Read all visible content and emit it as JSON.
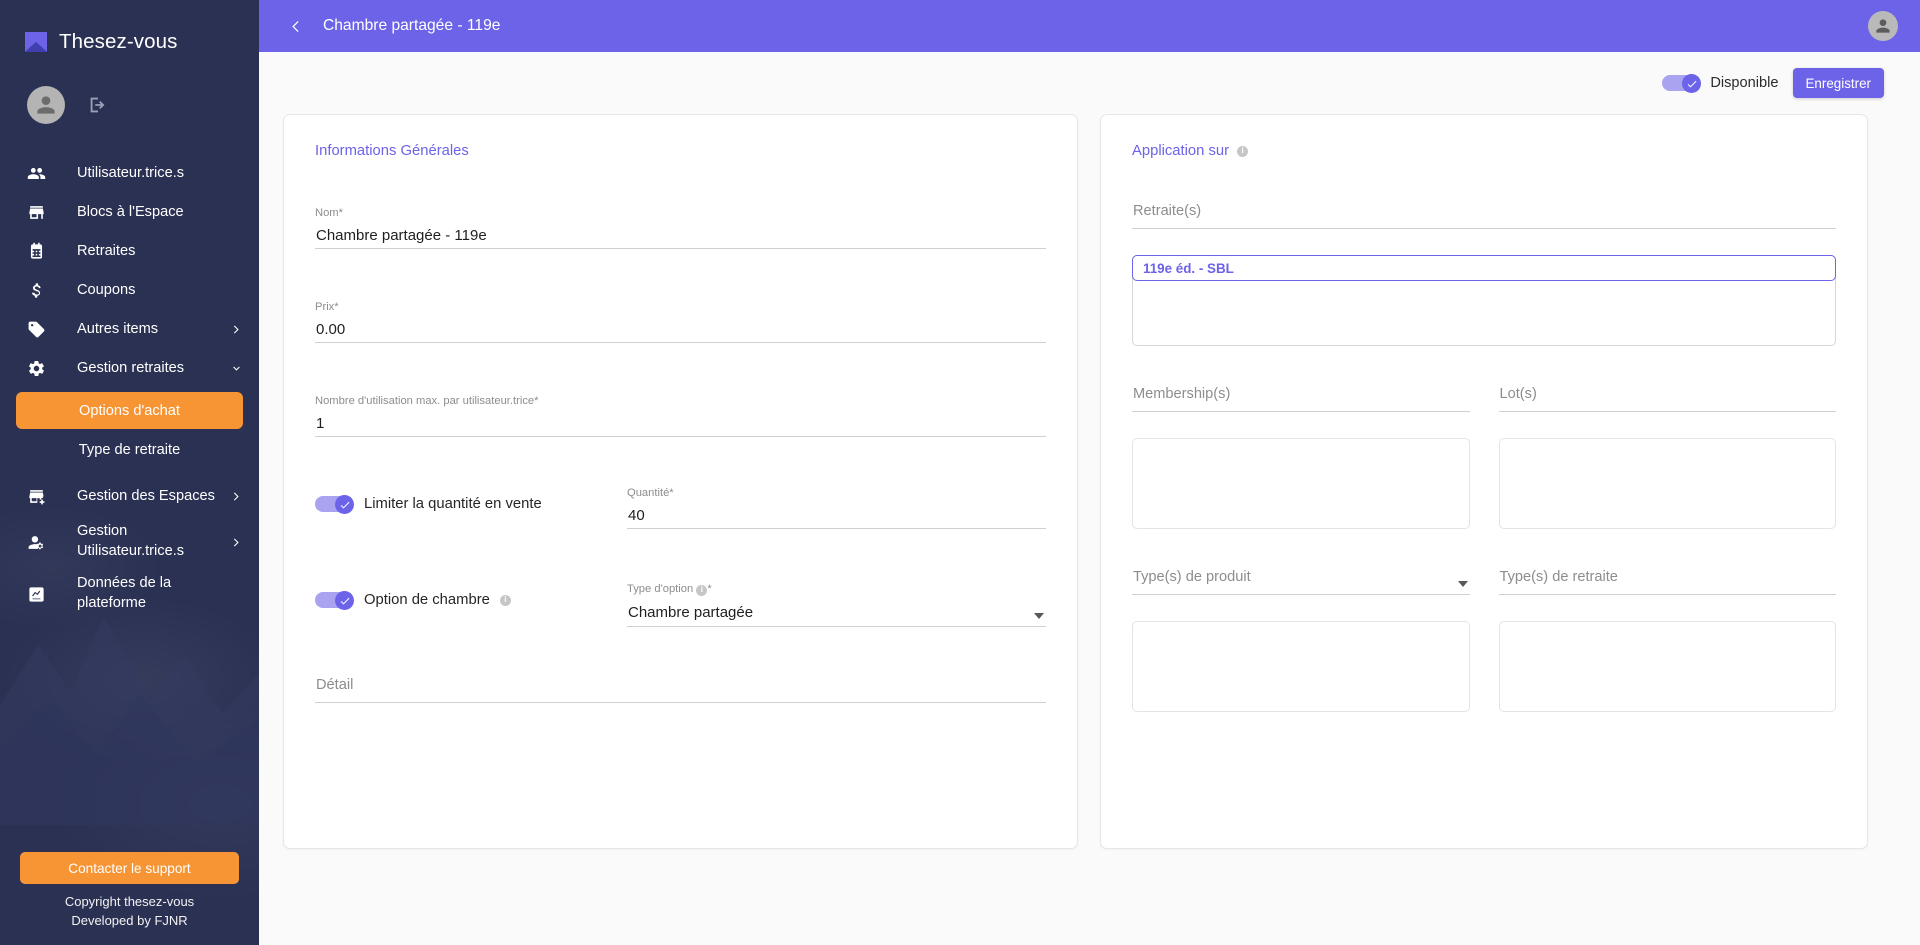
{
  "sidebar": {
    "brand": "Thesez-vous",
    "profile": {
      "avatar_icon": "person-icon",
      "logout_icon": "logout-icon"
    },
    "items": [
      {
        "label": "Utilisateur.trice.s",
        "icon": "people-icon",
        "chevron": ""
      },
      {
        "label": "Blocs à l'Espace",
        "icon": "store-icon",
        "chevron": ""
      },
      {
        "label": "Retraites",
        "icon": "calendar-icon",
        "chevron": ""
      },
      {
        "label": "Coupons",
        "icon": "dollar-icon",
        "chevron": ""
      },
      {
        "label": "Autres items",
        "icon": "tag-icon",
        "chevron": "chevron-right-icon"
      },
      {
        "label": "Gestion retraites",
        "icon": "gear-icon",
        "chevron": "chevron-down-icon"
      }
    ],
    "sub_items": [
      {
        "label": "Options d'achat",
        "active": true
      },
      {
        "label": "Type de retraite",
        "active": false
      }
    ],
    "items_after": [
      {
        "label": "Gestion des Espaces",
        "icon": "store-plus-icon",
        "chevron": "chevron-right-icon"
      },
      {
        "label": "Gestion Utilisateur.trice.s",
        "icon": "person-gear-icon",
        "chevron": "chevron-right-icon"
      },
      {
        "label": "Données de la plateforme",
        "icon": "analytics-icon",
        "chevron": ""
      }
    ],
    "support_button": "Contacter le support",
    "copyright_line1": "Copyright thesez-vous",
    "copyright_line2": "Developed by FJNR"
  },
  "topbar": {
    "back_icon": "chevron-left-icon",
    "title": "Chambre partagée - 119e",
    "avatar_icon": "person-icon"
  },
  "actions": {
    "available_toggle_label": "Disponible",
    "available_toggle_on": true,
    "save_label": "Enregistrer"
  },
  "left_panel": {
    "title": "Informations Générales",
    "fields": [
      {
        "label": "Nom",
        "required": "*",
        "value": "Chambre partagée - 119e"
      },
      {
        "label": "Prix",
        "required": "*",
        "value": "0.00"
      },
      {
        "label": "Nombre d'utilisation max. par utilisateur.trice",
        "required": "*",
        "value": "1"
      }
    ],
    "limit_toggle": {
      "label": "Limiter la quantité en vente",
      "on": true
    },
    "quantity_field": {
      "label": "Quantité",
      "required": "*",
      "value": "40"
    },
    "room_toggle": {
      "label": "Option de chambre",
      "on": true,
      "info_icon": "info-icon"
    },
    "option_type_field": {
      "label": "Type d'option",
      "required": "*",
      "info_icon": "info-icon",
      "value": "Chambre partagée",
      "caret": "caret-down-icon"
    },
    "detail_field": {
      "placeholder": "Détail",
      "value": ""
    }
  },
  "right_panel": {
    "title": "Application sur",
    "info_icon": "info-icon",
    "retreats_field": {
      "placeholder": "Retraite(s)"
    },
    "retreats_selected": [
      "119e éd. - SBL"
    ],
    "membership_field": {
      "placeholder": "Membership(s)"
    },
    "lots_field": {
      "placeholder": "Lot(s)"
    },
    "product_types_field": {
      "placeholder": "Type(s) de produit",
      "caret": "caret-down-icon"
    },
    "retreat_types_field": {
      "placeholder": "Type(s) de retraite"
    }
  },
  "colors": {
    "sidebar_bg": "#2b3153",
    "accent_purple": "#6c63e8",
    "accent_orange": "#f79433",
    "page_bg": "#fafafa"
  }
}
